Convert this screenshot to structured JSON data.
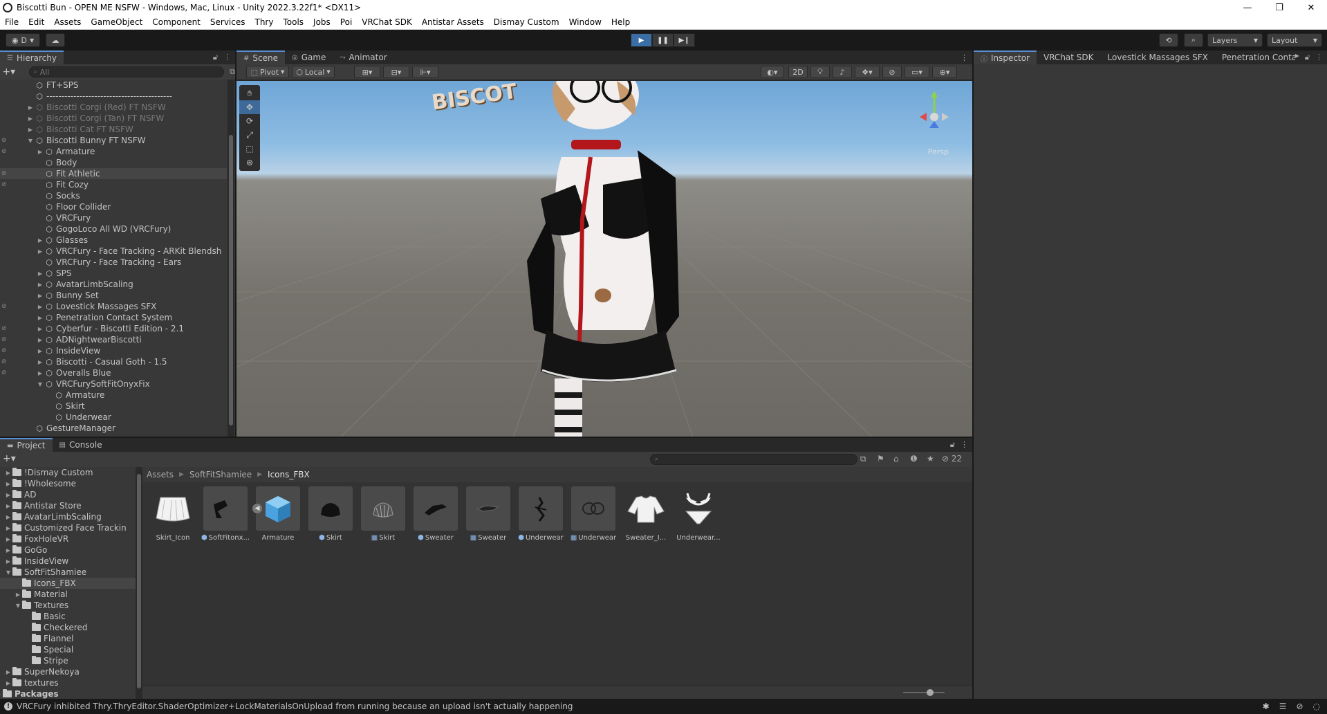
{
  "window": {
    "title": "Biscotti Bun - OPEN ME NSFW - Windows, Mac, Linux - Unity 2022.3.22f1* <DX11>",
    "minimize": "—",
    "maximize": "❐",
    "close": "✕"
  },
  "menu": [
    "File",
    "Edit",
    "Assets",
    "GameObject",
    "Component",
    "Services",
    "Thry",
    "Tools",
    "Jobs",
    "Poi",
    "VRChat SDK",
    "Antistar Assets",
    "Dismay Custom",
    "Window",
    "Help"
  ],
  "toolbar": {
    "account_label": "D",
    "layers_label": "Layers",
    "layout_label": "Layout"
  },
  "hierarchy": {
    "tab": "Hierarchy",
    "search_placeholder": "All",
    "rows": [
      {
        "label": "FT+SPS",
        "depth": 0,
        "arrow": "",
        "dim": false
      },
      {
        "label": "------------------------------------------",
        "depth": 0,
        "arrow": "",
        "dim": false
      },
      {
        "label": "Biscotti Corgi (Red) FT NSFW",
        "depth": 0,
        "arrow": "▶",
        "dim": true
      },
      {
        "label": "Biscotti Corgi (Tan) FT NSFW",
        "depth": 0,
        "arrow": "▶",
        "dim": true
      },
      {
        "label": "Biscotti Cat FT NSFW",
        "depth": 0,
        "arrow": "▶",
        "dim": true
      },
      {
        "label": "Biscotti Bunny FT NSFW",
        "depth": 0,
        "arrow": "▼",
        "dim": false
      },
      {
        "label": "Armature",
        "depth": 1,
        "arrow": "▶",
        "dim": false
      },
      {
        "label": "Body",
        "depth": 1,
        "arrow": "",
        "dim": false
      },
      {
        "label": "Fit Athletic",
        "depth": 1,
        "arrow": "",
        "dim": false,
        "sel": true
      },
      {
        "label": "Fit Cozy",
        "depth": 1,
        "arrow": "",
        "dim": false
      },
      {
        "label": "Socks",
        "depth": 1,
        "arrow": "",
        "dim": false
      },
      {
        "label": "Floor Collider",
        "depth": 1,
        "arrow": "",
        "dim": false
      },
      {
        "label": "VRCFury",
        "depth": 1,
        "arrow": "",
        "dim": false
      },
      {
        "label": "GogoLoco All WD (VRCFury)",
        "depth": 1,
        "arrow": "",
        "dim": false
      },
      {
        "label": "Glasses",
        "depth": 1,
        "arrow": "▶",
        "dim": false
      },
      {
        "label": "VRCFury - Face Tracking - ARKit Blendsh",
        "depth": 1,
        "arrow": "▶",
        "dim": false
      },
      {
        "label": "VRCFury - Face Tracking - Ears",
        "depth": 1,
        "arrow": "",
        "dim": false
      },
      {
        "label": "SPS",
        "depth": 1,
        "arrow": "▶",
        "dim": false
      },
      {
        "label": "AvatarLimbScaling",
        "depth": 1,
        "arrow": "▶",
        "dim": false
      },
      {
        "label": "Bunny Set",
        "depth": 1,
        "arrow": "▶",
        "dim": false
      },
      {
        "label": "Lovestick Massages SFX",
        "depth": 1,
        "arrow": "▶",
        "dim": false
      },
      {
        "label": "Penetration Contact System",
        "depth": 1,
        "arrow": "▶",
        "dim": false
      },
      {
        "label": "Cyberfur - Biscotti Edition - 2.1",
        "depth": 1,
        "arrow": "▶",
        "dim": false
      },
      {
        "label": "ADNightwearBiscotti",
        "depth": 1,
        "arrow": "▶",
        "dim": false
      },
      {
        "label": "InsideView",
        "depth": 1,
        "arrow": "▶",
        "dim": false
      },
      {
        "label": "Biscotti  - Casual Goth - 1.5",
        "depth": 1,
        "arrow": "▶",
        "dim": false
      },
      {
        "label": "Overalls Blue",
        "depth": 1,
        "arrow": "▶",
        "dim": false
      },
      {
        "label": "VRCFurySoftFitOnyxFix",
        "depth": 1,
        "arrow": "▼",
        "dim": false
      },
      {
        "label": "Armature",
        "depth": 2,
        "arrow": "",
        "dim": false
      },
      {
        "label": "Skirt",
        "depth": 2,
        "arrow": "",
        "dim": false
      },
      {
        "label": "Underwear",
        "depth": 2,
        "arrow": "",
        "dim": false
      },
      {
        "label": "GestureManager",
        "depth": 0,
        "arrow": "",
        "dim": false
      }
    ]
  },
  "scene": {
    "tabs": [
      "Scene",
      "Game",
      "Animator"
    ],
    "pivot": "Pivot",
    "local": "Local",
    "mode_2d": "2D",
    "persp": "Persp",
    "sign_text": "BISCOT"
  },
  "inspector": {
    "tabs": [
      "Inspector",
      "VRChat SDK",
      "Lovestick Massages SFX",
      "Penetration Conta"
    ]
  },
  "project": {
    "tabs": [
      "Project",
      "Console"
    ],
    "tree": [
      {
        "label": "!Dismay Custom",
        "depth": 0,
        "arrow": "▶"
      },
      {
        "label": "!Wholesome",
        "depth": 0,
        "arrow": "▶"
      },
      {
        "label": "AD",
        "depth": 0,
        "arrow": "▶"
      },
      {
        "label": "Antistar Store",
        "depth": 0,
        "arrow": "▶"
      },
      {
        "label": "AvatarLimbScaling",
        "depth": 0,
        "arrow": "▶"
      },
      {
        "label": "Customized Face Trackin",
        "depth": 0,
        "arrow": "▶"
      },
      {
        "label": "FoxHoleVR",
        "depth": 0,
        "arrow": "▶"
      },
      {
        "label": "GoGo",
        "depth": 0,
        "arrow": "▶"
      },
      {
        "label": "InsideView",
        "depth": 0,
        "arrow": "▶"
      },
      {
        "label": "SoftFitShamiee",
        "depth": 0,
        "arrow": "▼"
      },
      {
        "label": "Icons_FBX",
        "depth": 1,
        "arrow": "",
        "sel": true
      },
      {
        "label": "Material",
        "depth": 1,
        "arrow": "▶"
      },
      {
        "label": "Textures",
        "depth": 1,
        "arrow": "▼"
      },
      {
        "label": "Basic",
        "depth": 2,
        "arrow": ""
      },
      {
        "label": "Checkered",
        "depth": 2,
        "arrow": ""
      },
      {
        "label": "Flannel",
        "depth": 2,
        "arrow": ""
      },
      {
        "label": "Special",
        "depth": 2,
        "arrow": ""
      },
      {
        "label": "Stripe",
        "depth": 2,
        "arrow": ""
      },
      {
        "label": "SuperNekoya",
        "depth": 0,
        "arrow": "▶"
      },
      {
        "label": "textures",
        "depth": 0,
        "arrow": "▶"
      },
      {
        "label": "Packages",
        "depth": -1,
        "arrow": "▶",
        "bold": true
      }
    ],
    "breadcrumb": [
      "Assets",
      "SoftFitShamiee",
      "Icons_FBX"
    ],
    "hidden_count": "22",
    "assets": [
      {
        "label": "Skirt_Icon",
        "kind": "skirt-icon",
        "mini": ""
      },
      {
        "label": "SoftFitonx...",
        "kind": "fbx-black",
        "mini": "⬢",
        "grp": true
      },
      {
        "label": "Armature",
        "kind": "prefab",
        "mini": "",
        "grp": true
      },
      {
        "label": "Skirt",
        "kind": "skirt-black",
        "mini": "⬢",
        "grp": true
      },
      {
        "label": "Skirt",
        "kind": "skirt-mesh",
        "mini": "▦",
        "grp": true
      },
      {
        "label": "Sweater",
        "kind": "sweater-black",
        "mini": "⬢",
        "grp": true
      },
      {
        "label": "Sweater",
        "kind": "sweater-mesh",
        "mini": "▦",
        "grp": true
      },
      {
        "label": "Underwear",
        "kind": "underwear-black",
        "mini": "⬢",
        "grp": true
      },
      {
        "label": "Underwear",
        "kind": "underwear-mesh",
        "mini": "▦",
        "grp": true
      },
      {
        "label": "Sweater_I...",
        "kind": "sweater-icon",
        "mini": ""
      },
      {
        "label": "Underwear...",
        "kind": "underwear-icon",
        "mini": ""
      }
    ]
  },
  "status": {
    "message": "VRCFury inhibited Thry.ThryEditor.ShaderOptimizer+LockMaterialsOnUpload from running because an upload isn't actually happening"
  }
}
